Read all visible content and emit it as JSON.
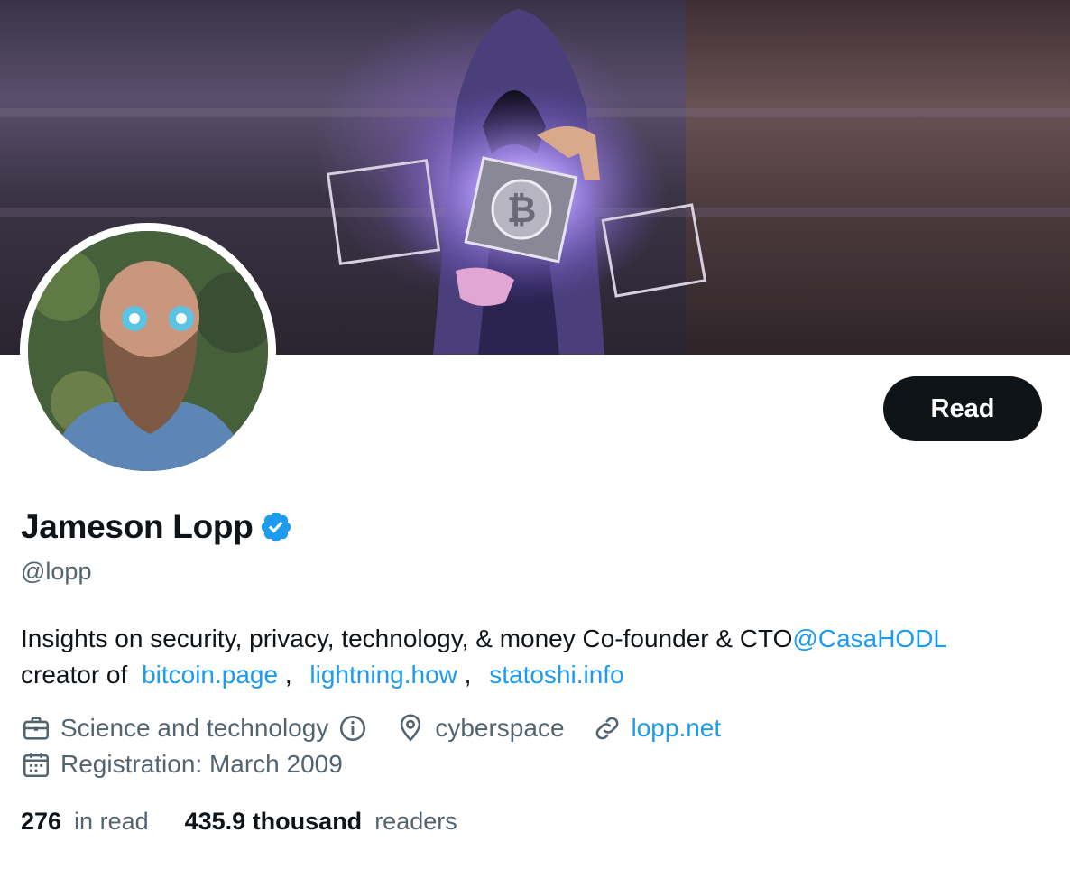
{
  "profile": {
    "read_label": "Read",
    "name": "Jameson Lopp",
    "handle": "@lopp",
    "bio": {
      "line1_text": "Insights on security, privacy, technology, & money Co-founder & CTO",
      "mention": "@CasaHODL",
      "line2_prefix": "creator of ",
      "link1": "bitcoin.page",
      "sep1": ",",
      "link2": "lightning.how",
      "sep2": ",",
      "link3": "statoshi.info"
    },
    "meta": {
      "category": "Science and technology",
      "location": "cyberspace",
      "website": "lopp.net",
      "joined": "Registration: March 2009"
    },
    "stats": {
      "following_count": "276",
      "following_label": "in read",
      "followers_count": "435.9 thousand",
      "followers_label": "readers"
    }
  },
  "colors": {
    "accent": "#1d9bf0",
    "text": "#0f1419",
    "secondary": "#536471",
    "button_bg": "#0f1419"
  },
  "icons": [
    "verified-badge-icon",
    "briefcase-icon",
    "info-icon",
    "location-pin-icon",
    "link-icon",
    "calendar-icon"
  ]
}
